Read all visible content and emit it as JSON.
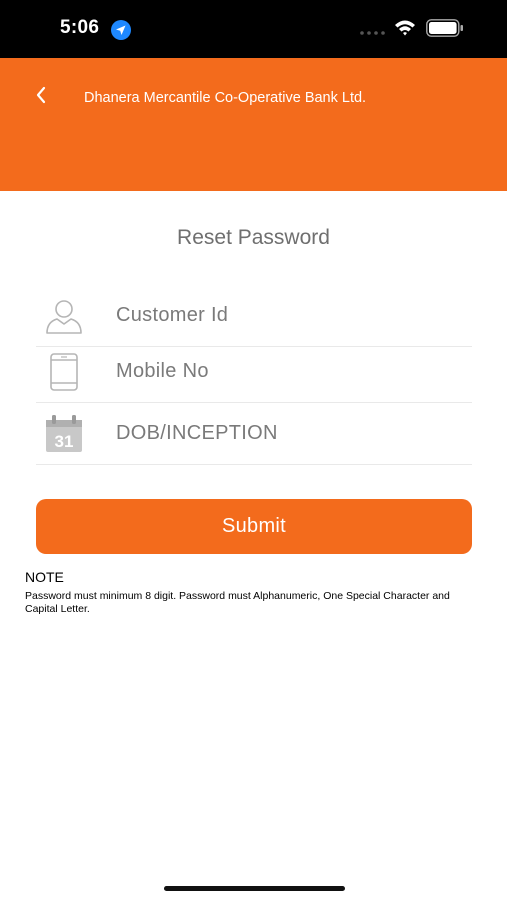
{
  "status_bar": {
    "time": "5:06"
  },
  "header": {
    "title": "Dhanera Mercantile Co-Operative Bank Ltd.",
    "back_icon": "chevron-left-icon",
    "background_color": "#f36b1c"
  },
  "page": {
    "title": "Reset Password"
  },
  "form": {
    "customer_id": {
      "placeholder": "Customer Id",
      "value": "",
      "icon": "user-icon"
    },
    "mobile_no": {
      "placeholder": "Mobile No",
      "value": "",
      "icon": "mobile-phone-icon"
    },
    "dob": {
      "placeholder": "DOB/INCEPTION",
      "value": "",
      "icon": "calendar-icon",
      "icon_text": "31"
    }
  },
  "submit": {
    "label": "Submit"
  },
  "note": {
    "heading": "NOTE",
    "text": "Password must minimum 8 digit. Password must Alphanumeric, One Special Character and Capital Letter."
  }
}
